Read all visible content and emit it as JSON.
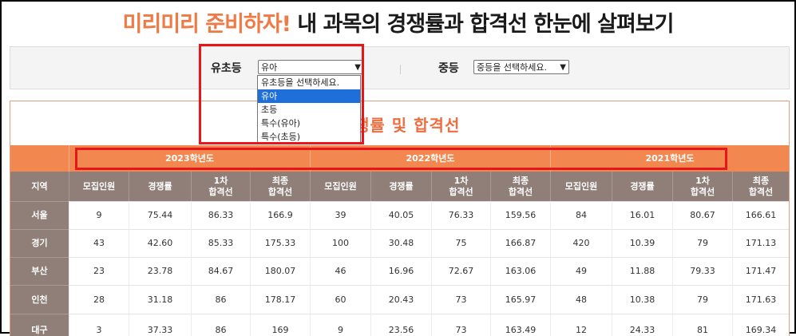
{
  "header": {
    "title_accent": "미리미리 준비하자!",
    "title_rest": "내 과목의 경쟁률과 합격선 한눈에 살펴보기"
  },
  "filters": {
    "elementary": {
      "label": "유초등",
      "selected": "유아",
      "options": [
        "유초등을 선택하세요.",
        "유아",
        "초등",
        "특수(유아)",
        "특수(초등)"
      ],
      "highlighted_index": 1
    },
    "secondary": {
      "label": "중등",
      "selected": "중등을 선택하세요."
    }
  },
  "table": {
    "title": "경쟁률 및 합격선",
    "years": [
      "2023학년도",
      "2022학년도",
      "2021학년도"
    ],
    "region_header": "지역",
    "col_headers": [
      "모집인원",
      "경쟁률",
      "1차\n합격선",
      "최종\n합격선"
    ],
    "rows": [
      {
        "region": "서울",
        "values": [
          "9",
          "75.44",
          "86.33",
          "166.9",
          "39",
          "40.05",
          "76.33",
          "159.56",
          "84",
          "16.01",
          "80.67",
          "166.61"
        ]
      },
      {
        "region": "경기",
        "values": [
          "43",
          "42.60",
          "85.33",
          "175.33",
          "100",
          "30.48",
          "75",
          "166.87",
          "420",
          "10.39",
          "79",
          "171.13"
        ]
      },
      {
        "region": "부산",
        "values": [
          "23",
          "23.78",
          "84.67",
          "180.07",
          "46",
          "16.96",
          "72.67",
          "163.06",
          "49",
          "11.88",
          "79.33",
          "171.47"
        ]
      },
      {
        "region": "인천",
        "values": [
          "28",
          "31.18",
          "86",
          "178.17",
          "60",
          "20.43",
          "73",
          "165.97",
          "48",
          "10.38",
          "79",
          "171.63"
        ]
      },
      {
        "region": "대구",
        "values": [
          "3",
          "37.33",
          "86",
          "169",
          "9",
          "23.56",
          "73",
          "163.49",
          "12",
          "24.33",
          "81",
          "169.34"
        ]
      }
    ]
  },
  "colors": {
    "accent": "#f07a46",
    "header_bar": "#f2874f",
    "region_col": "#8f7f78",
    "highlight_box": "#e8161b",
    "option_selected": "#1e6fd9"
  }
}
